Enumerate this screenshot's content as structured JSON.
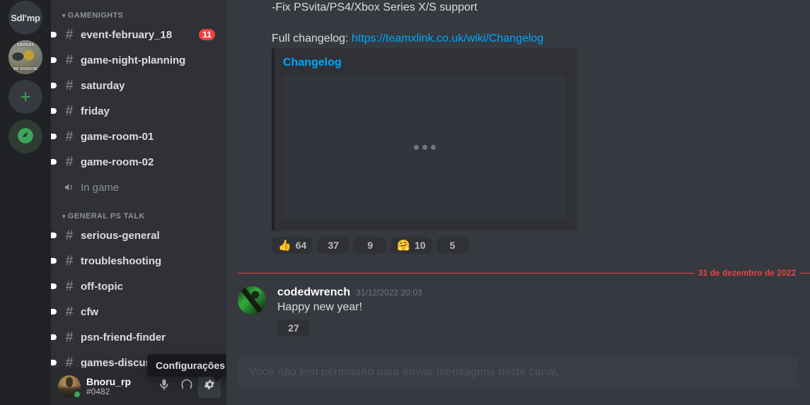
{
  "servers": [
    {
      "id": "sdlmp",
      "label": "Sdl'mp",
      "type": "text",
      "name": "server-icon-sdlmp"
    },
    {
      "id": "art",
      "label": "",
      "top_text": "SNIPERS",
      "bottom_text": "BR SHADOW",
      "type": "image",
      "name": "server-icon-art"
    },
    {
      "id": "add",
      "label": "+",
      "type": "action-add",
      "name": "add-server-button"
    },
    {
      "id": "explore",
      "label": "",
      "type": "action-compass",
      "name": "explore-servers-button"
    }
  ],
  "sidebar": {
    "categories": [
      {
        "label": "GAMENIGHTS",
        "channels": [
          {
            "name": "event-february_18",
            "icon": "hash-icon",
            "unread": true,
            "badge": "11"
          },
          {
            "name": "game-night-planning",
            "icon": "hash-icon",
            "unread": true,
            "badge": ""
          },
          {
            "name": "saturday",
            "icon": "hash-icon",
            "unread": true,
            "badge": ""
          },
          {
            "name": "friday",
            "icon": "hash-icon",
            "unread": true,
            "badge": ""
          },
          {
            "name": "game-room-01",
            "icon": "hash-icon",
            "unread": true,
            "badge": ""
          },
          {
            "name": "game-room-02",
            "icon": "hash-icon",
            "unread": true,
            "badge": ""
          },
          {
            "name": "In game",
            "icon": "speaker-icon",
            "unread": false,
            "badge": "",
            "muted": true
          }
        ]
      },
      {
        "label": "GENERAL PS TALK",
        "channels": [
          {
            "name": "serious-general",
            "icon": "hash-icon",
            "unread": true,
            "badge": ""
          },
          {
            "name": "troubleshooting",
            "icon": "hash-icon",
            "unread": true,
            "badge": ""
          },
          {
            "name": "off-topic",
            "icon": "hash-icon",
            "unread": true,
            "badge": ""
          },
          {
            "name": "cfw",
            "icon": "hash-icon",
            "unread": true,
            "badge": ""
          },
          {
            "name": "psn-friend-finder",
            "icon": "hash-icon",
            "unread": true,
            "badge": ""
          },
          {
            "name": "games-discussion",
            "icon": "hash-icon",
            "unread": true,
            "badge": ""
          }
        ]
      }
    ]
  },
  "user_panel": {
    "username": "Bnoru_rp",
    "discriminator": "#0482",
    "status": "online",
    "status_color": "#3ba55d",
    "buttons": [
      {
        "name": "mute-microphone-button",
        "icon": "microphone-icon"
      },
      {
        "name": "deafen-button",
        "icon": "headphones-icon"
      },
      {
        "name": "user-settings-button",
        "icon": "gear-icon",
        "active": true
      }
    ],
    "tooltip": "Configurações de Usuário"
  },
  "chat": {
    "top_message": {
      "line1": "-Fix PSvita/PS4/Xbox Series X/S support",
      "changelog_label": "Full changelog: ",
      "changelog_url": "https://teamxlink.co.uk/wiki/Changelog",
      "embed": {
        "title": "Changelog",
        "loading": true
      },
      "reactions": [
        {
          "emoji": "👍",
          "count": "64",
          "has_emoji": true
        },
        {
          "emoji": "",
          "count": "37",
          "has_emoji": false
        },
        {
          "emoji": "",
          "count": "9",
          "has_emoji": false
        },
        {
          "emoji": "🤗",
          "count": "10",
          "has_emoji": true
        },
        {
          "emoji": "",
          "count": "5",
          "has_emoji": false
        }
      ]
    },
    "divider": {
      "date": "31 de dezembro de 2022",
      "color": "#ed4245"
    },
    "message": {
      "author": "codedwrench",
      "timestamp": "31/12/2022 20:03",
      "text": "Happy new year!",
      "reactions": [
        {
          "emoji": "",
          "count": "27",
          "has_emoji": false
        }
      ]
    },
    "composer_placeholder": "Você não tem permissão para enviar mensagens neste canal."
  },
  "colors": {
    "rail_bg": "#202225",
    "sidebar_bg": "#2f3136",
    "chat_bg": "#36393f",
    "link": "#00a8fc",
    "accent_red": "#ed4245",
    "online_green": "#3ba55d"
  }
}
